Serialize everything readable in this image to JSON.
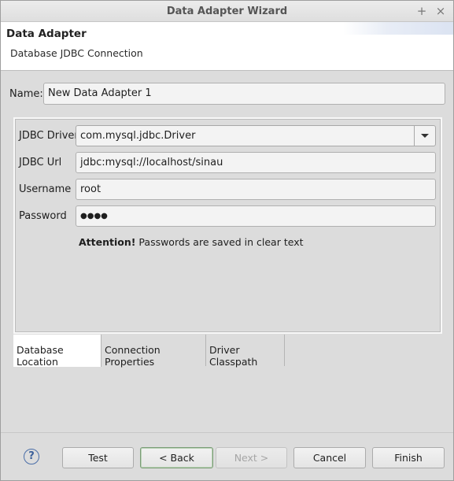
{
  "window": {
    "title": "Data Adapter Wizard",
    "add_glyph": "+",
    "close_glyph": "×"
  },
  "header": {
    "title": "Data Adapter",
    "description": "Database JDBC Connection"
  },
  "name": {
    "label": "Name:",
    "value": "New Data Adapter 1"
  },
  "form": {
    "driver": {
      "label": "JDBC Driver",
      "value": "com.mysql.jdbc.Driver"
    },
    "url": {
      "label": "JDBC Url",
      "value": "jdbc:mysql://localhost/sinau"
    },
    "username": {
      "label": "Username",
      "value": "root"
    },
    "password": {
      "label": "Password",
      "value": "●●●●"
    },
    "attention_strong": "Attention!",
    "attention_text": " Passwords are saved in clear text"
  },
  "tabs": [
    {
      "label": "Database Location",
      "active": true
    },
    {
      "label": "Connection Properties",
      "active": false
    },
    {
      "label": "Driver Classpath",
      "active": false
    }
  ],
  "footer": {
    "help_glyph": "?",
    "test": "Test",
    "back": "< Back",
    "next": "Next >",
    "cancel": "Cancel",
    "finish": "Finish"
  }
}
